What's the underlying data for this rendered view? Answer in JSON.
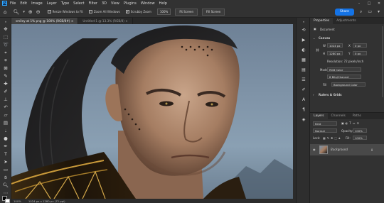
{
  "app": {
    "logo": "Ps"
  },
  "menu": [
    "File",
    "Edit",
    "Image",
    "Layer",
    "Type",
    "Select",
    "Filter",
    "3D",
    "View",
    "Plugins",
    "Window",
    "Help"
  ],
  "window_controls": [
    "–",
    "□",
    "✕"
  ],
  "options": {
    "resize_windows": "Resize Windows to Fit",
    "zoom_all": "Zoom All Windows",
    "scrubby_zoom": "Scrubby Zoom",
    "zoom_value": "100%",
    "fit_screen": "Fit Screen",
    "fill_screen": "Fill Screen",
    "share": "Share"
  },
  "tabs": [
    {
      "label": "smiley at 1% png @ 100% (RGB/8#) ×"
    },
    {
      "label": "Untitled-1 @ 13.3% (RGB/8) ×"
    }
  ],
  "status": {
    "zoom": "100%",
    "doc": "1024 px x 1280 px (72 ppi)"
  },
  "properties": {
    "tab_properties": "Properties",
    "tab_adjustments": "Adjustments",
    "document_label": "Document",
    "canvas_section": "Canvas",
    "w_label": "W",
    "w_value": "1024 px",
    "h_label": "H",
    "h_value": "1280 px",
    "x_label": "X",
    "x_value": "0 px",
    "y_label": "Y",
    "y_value": "0 px",
    "resolution": "Resolution: 72 pixels/inch",
    "mode_label": "Mode",
    "mode_value": "RGB Color",
    "bit_value": "8 Bits/Channel",
    "fill_label": "Fill",
    "fill_value": "Background Color",
    "rulers_section": "Rulers & Grids"
  },
  "layers": {
    "tab_layers": "Layers",
    "tab_channels": "Channels",
    "tab_paths": "Paths",
    "kind_placeholder": "Kind",
    "blend_mode": "Normal",
    "opacity_label": "Opacity:",
    "opacity_value": "100%",
    "lock_label": "Lock:",
    "fill_label": "Fill:",
    "fill_value": "100%",
    "layer_name": "Background"
  }
}
